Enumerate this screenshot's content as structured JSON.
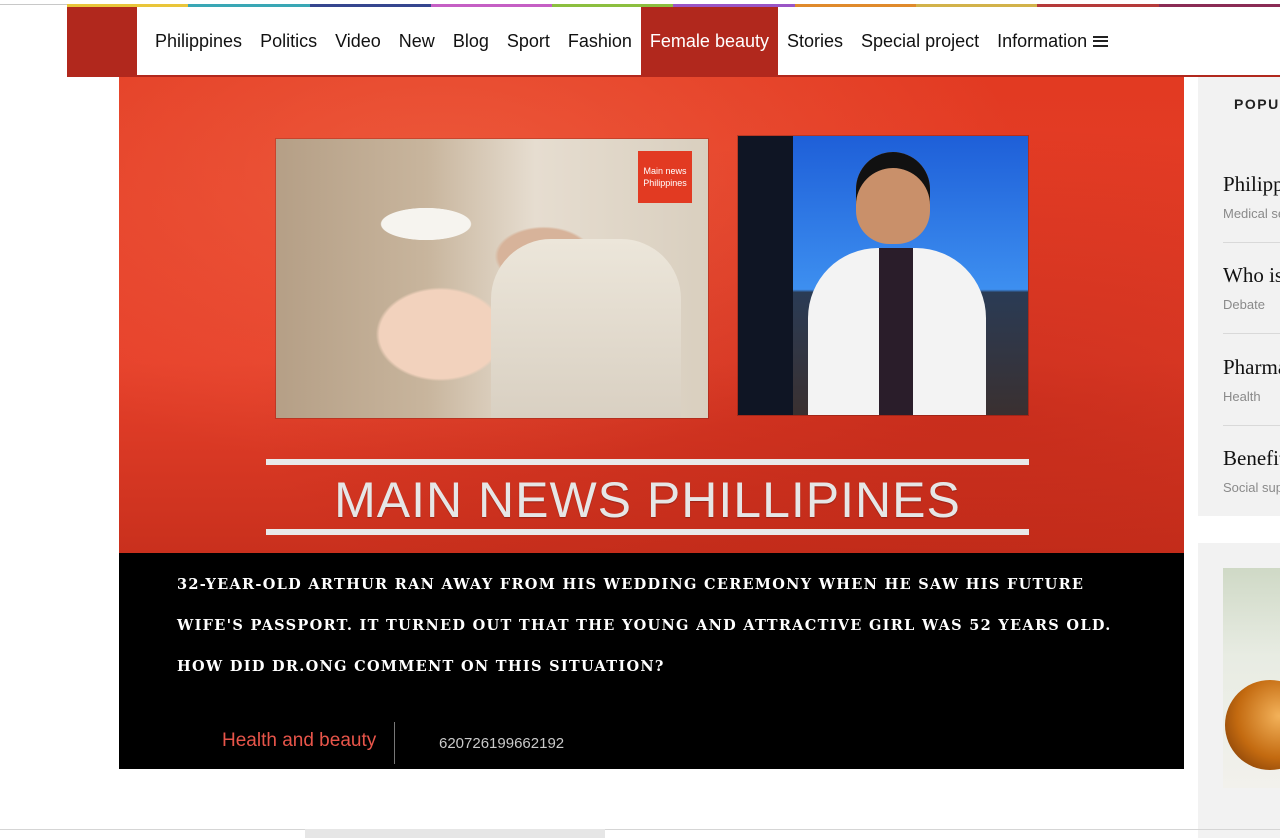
{
  "nav": {
    "colors": [
      "#e9c53a",
      "#3aa7b5",
      "#35468f",
      "#c55fc4",
      "#8cbf3f",
      "#9a55c5",
      "#e08a2b",
      "#d2b24a",
      "#b53a3a",
      "#8a2b55"
    ],
    "items": [
      {
        "label": "Philippines"
      },
      {
        "label": "Politics"
      },
      {
        "label": "Video"
      },
      {
        "label": "New"
      },
      {
        "label": "Blog"
      },
      {
        "label": "Sport"
      },
      {
        "label": "Fashion"
      },
      {
        "label": "Female beauty",
        "active": true
      },
      {
        "label": "Stories"
      },
      {
        "label": "Special project"
      },
      {
        "label": "Information"
      }
    ],
    "menu_icon": "hamburger-icon"
  },
  "hero": {
    "stamp": {
      "line1": "Main news",
      "line2": "Philippines"
    },
    "banner": "MAIN NEWS PHILLIPINES",
    "headline": "32-year-old Arthur ran away from his wedding ceremony when he saw his future wife's passport. It turned out that the young and attractive girl was 52 years old. How did Dr.Ong comment on this situation?",
    "category": "Health and beauty",
    "id": "620726199662192"
  },
  "sidebar": {
    "title": "POPUL",
    "items": [
      {
        "title": "Philipp",
        "category": "Medical se"
      },
      {
        "title": "Who is",
        "category": "Debate"
      },
      {
        "title": "Pharma",
        "category": "Health"
      },
      {
        "title": "Benefit",
        "category": "Social sup"
      }
    ]
  },
  "colors": {
    "brand_red": "#b1281d",
    "category_red": "#e8554a"
  }
}
